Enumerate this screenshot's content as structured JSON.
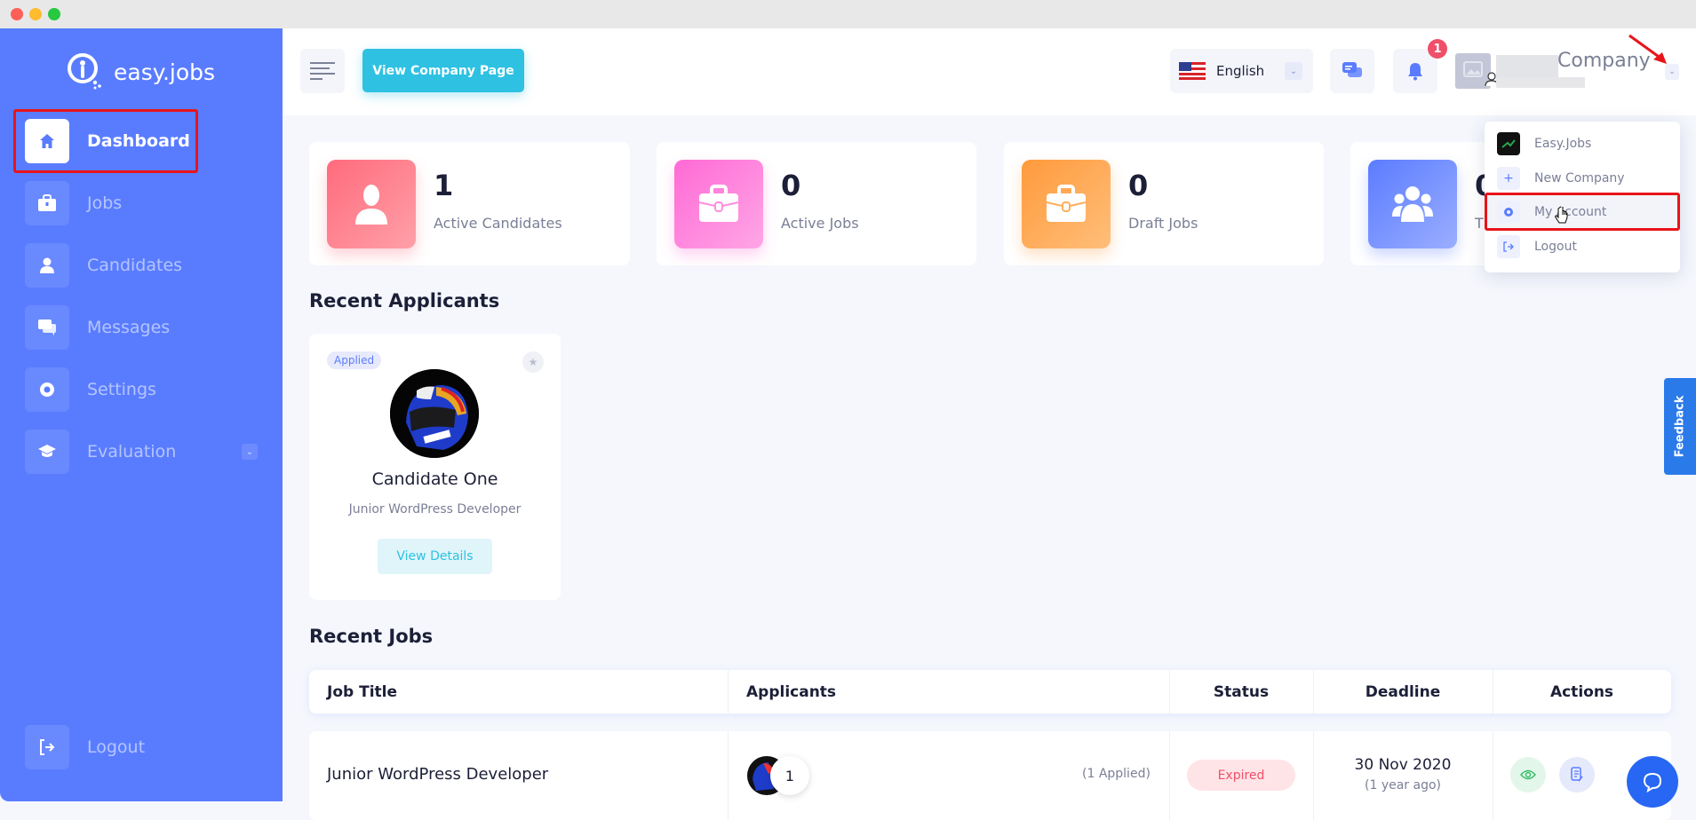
{
  "window": {
    "controls": [
      "close",
      "minimize",
      "maximize"
    ]
  },
  "sidebar": {
    "brand": "easy.jobs",
    "items": [
      {
        "label": "Dashboard",
        "icon": "home-icon",
        "active": true
      },
      {
        "label": "Jobs",
        "icon": "briefcase-icon",
        "active": false
      },
      {
        "label": "Candidates",
        "icon": "user-icon",
        "active": false
      },
      {
        "label": "Messages",
        "icon": "chat-icon",
        "active": false
      },
      {
        "label": "Settings",
        "icon": "gear-icon",
        "active": false
      },
      {
        "label": "Evaluation",
        "icon": "graduation-cap-icon",
        "active": false
      }
    ],
    "logout": "Logout"
  },
  "header": {
    "view_company_label": "View Company Page",
    "language": "English",
    "notification_count": "1",
    "company_name": "Company"
  },
  "stats": [
    {
      "value": "1",
      "label": "Active Candidates",
      "color_from": "#ff6b7d",
      "color_to": "#ffa0a8"
    },
    {
      "value": "0",
      "label": "Active Jobs",
      "color_from": "#ff6ad5",
      "color_to": "#ffa6e6"
    },
    {
      "value": "0",
      "label": "Draft Jobs",
      "color_from": "#ff9a3c",
      "color_to": "#ffbe7a"
    },
    {
      "value": "0",
      "label": "T",
      "color_from": "#5b7cff",
      "color_to": "#9aaeff"
    }
  ],
  "recent_applicants": {
    "heading": "Recent Applicants",
    "cards": [
      {
        "status": "Applied",
        "name": "Candidate One",
        "position": "Junior WordPress Developer",
        "button": "View Details"
      }
    ]
  },
  "recent_jobs": {
    "heading": "Recent Jobs",
    "columns": [
      "Job Title",
      "Applicants",
      "Status",
      "Deadline",
      "Actions"
    ],
    "rows": [
      {
        "title": "Junior WordPress Developer",
        "applicant_count": "1",
        "applied_text": "(1 Applied)",
        "status": "Expired",
        "deadline": "30 Nov 2020",
        "deadline_relative": "(1 year ago)"
      }
    ]
  },
  "user_dropdown": {
    "items": [
      {
        "label": "Easy.Jobs",
        "icon": "company-logo-icon"
      },
      {
        "label": "New Company",
        "icon": "plus-icon"
      },
      {
        "label": "My Account",
        "icon": "gear-icon",
        "highlighted": true
      },
      {
        "label": "Logout",
        "icon": "logout-icon"
      }
    ]
  },
  "feedback_label": "Feedback",
  "colors": {
    "sidebar": "#597cff",
    "accent_cyan": "#2ec1e2",
    "highlight": "#e8141a",
    "expired": "#f04f6a"
  }
}
